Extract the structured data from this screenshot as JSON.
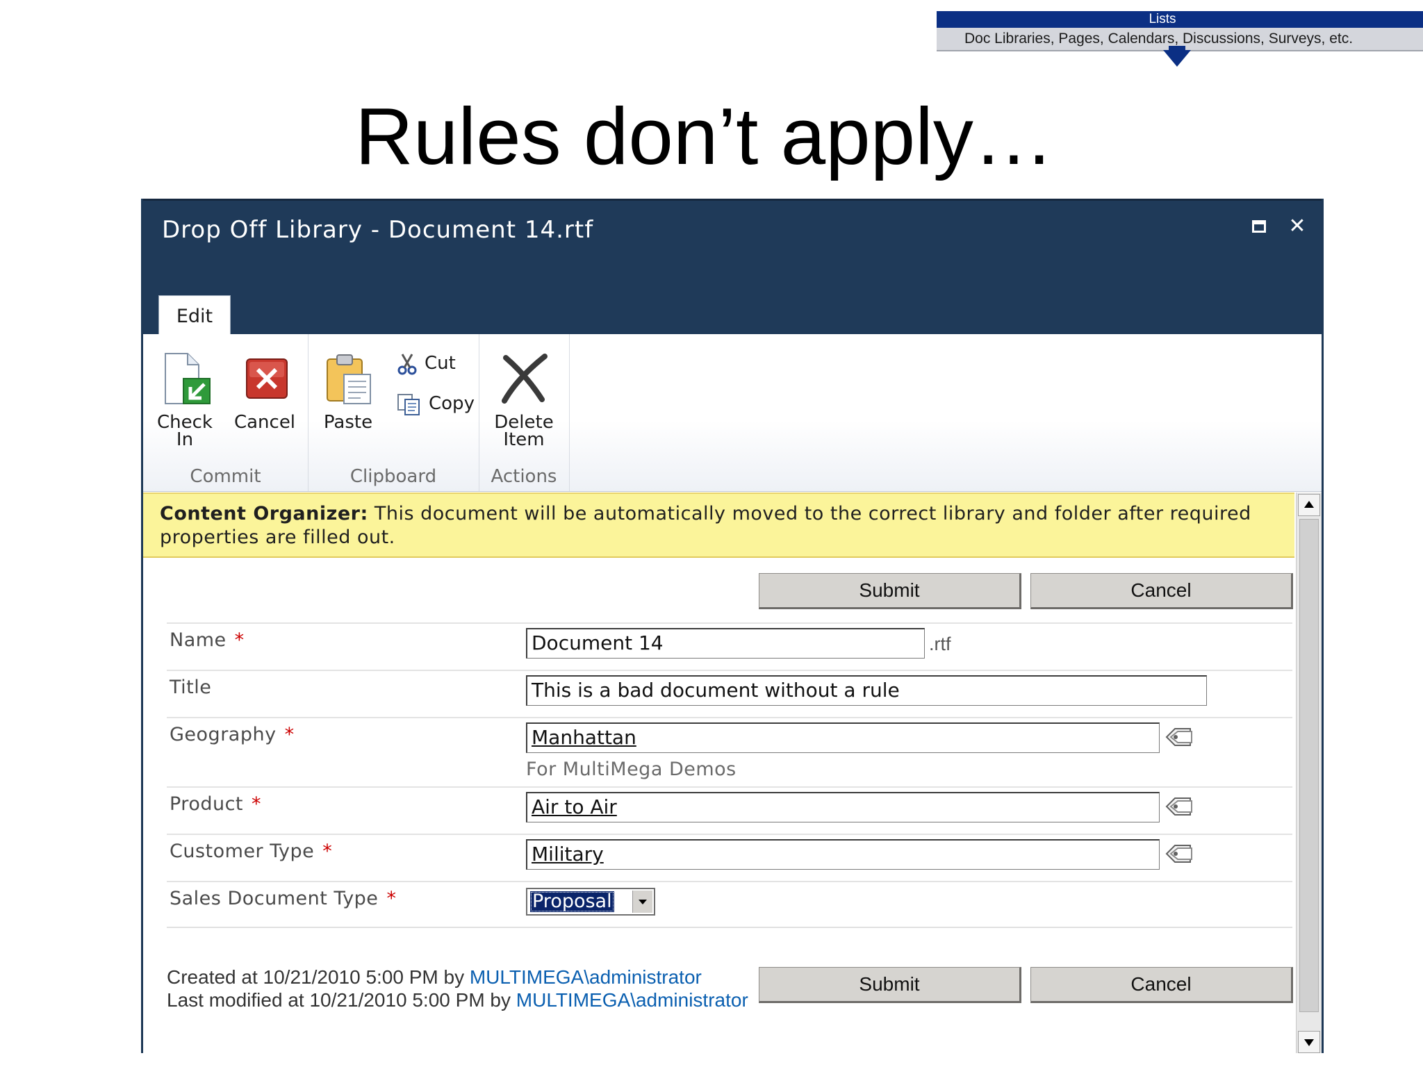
{
  "banner": {
    "title": "Lists",
    "subtitle": "Doc Libraries, Pages, Calendars, Discussions, Surveys, etc."
  },
  "slide": {
    "title": "Rules don’t apply…"
  },
  "dialog": {
    "title": "Drop Off Library - Document 14.rtf",
    "tab": "Edit"
  },
  "ribbon": {
    "commit": {
      "label": "Commit",
      "check_in": "Check In",
      "cancel": "Cancel"
    },
    "clipboard": {
      "label": "Clipboard",
      "paste": "Paste",
      "cut": "Cut",
      "copy": "Copy"
    },
    "actions": {
      "label": "Actions",
      "delete_item": "Delete Item"
    }
  },
  "notice": {
    "bold": "Content Organizer:",
    "text": " This document will be automatically moved to the correct library and folder after required properties are filled out."
  },
  "buttons": {
    "submit": "Submit",
    "cancel": "Cancel"
  },
  "form": {
    "name": {
      "label": "Name",
      "value": "Document 14",
      "suffix": ".rtf"
    },
    "title": {
      "label": "Title",
      "value": "This is a bad document without a rule"
    },
    "geography": {
      "label": "Geography",
      "value": "Manhattan",
      "hint": "For MultiMega Demos"
    },
    "product": {
      "label": "Product",
      "value": "Air to Air"
    },
    "customer_type": {
      "label": "Customer Type",
      "value": "Military"
    },
    "sales_document_type": {
      "label": "Sales Document Type",
      "value": "Proposal"
    },
    "required_marker": "*"
  },
  "meta": {
    "created_prefix": "Created at 10/21/2010 5:00 PM  by ",
    "created_user": "MULTIMEGA\\administrator",
    "modified_prefix": "Last modified at 10/21/2010 5:00 PM  by ",
    "modified_user": "MULTIMEGA\\administrator"
  },
  "colors": {
    "dialog_header": "#1f3a59",
    "notice_bg": "#fbf49a",
    "link": "#0a5fb0",
    "required": "#cc0000",
    "banner": "#0b2f84"
  }
}
